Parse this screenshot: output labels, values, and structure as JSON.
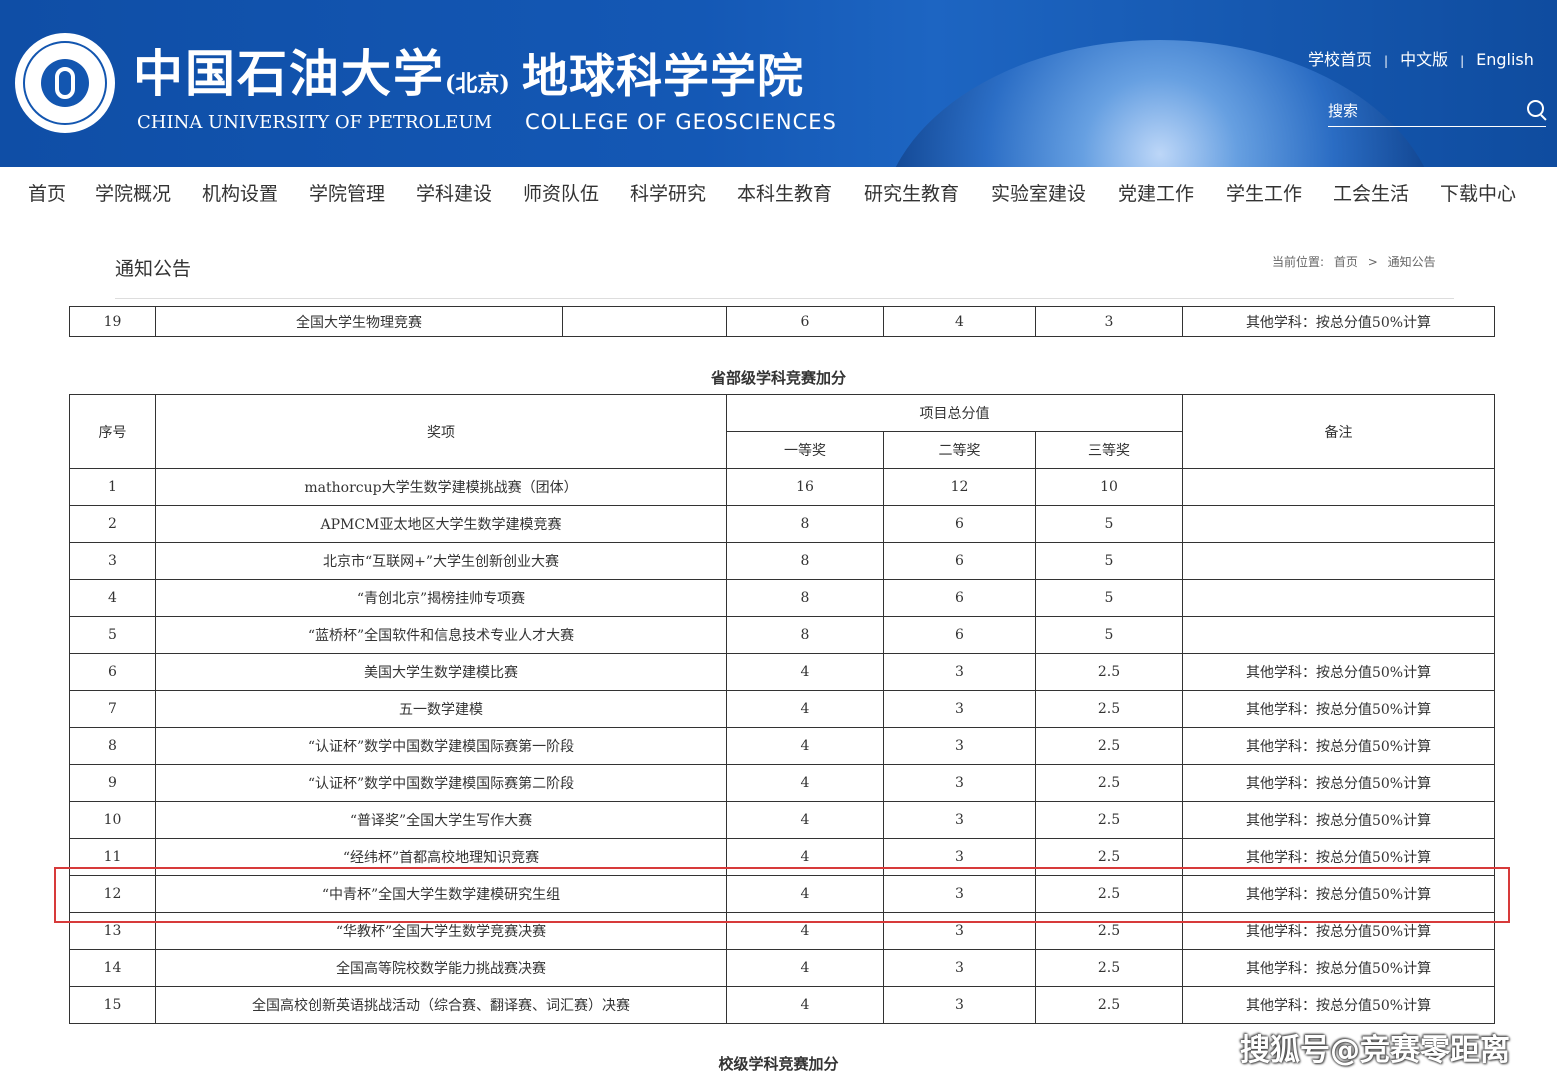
{
  "header": {
    "cn_university": "中国石油大学",
    "cn_university_suffix": "(北京)",
    "cn_college": "地球科学学院",
    "en_university": "CHINA UNIVERSITY OF PETROLEUM",
    "en_college": "COLLEGE OF GEOSCIENCES",
    "links": [
      "学校首页",
      "中文版",
      "English"
    ],
    "search_placeholder": "搜索"
  },
  "nav": [
    "首页",
    "学院概况",
    "机构设置",
    "学院管理",
    "学科建设",
    "师资队伍",
    "科学研究",
    "本科生教育",
    "研究生教育",
    "实验室建设",
    "党建工作",
    "学生工作",
    "工会生活",
    "下载中心"
  ],
  "page": {
    "title": "通知公告",
    "breadcrumb_label": "当前位置:",
    "breadcrumb": [
      "首页",
      ">",
      "通知公告"
    ]
  },
  "top_row": {
    "no": "19",
    "name": "全国大学生物理竞赛",
    "first": "6",
    "second": "4",
    "third": "3",
    "note": "其他学科：按总分值50%计算"
  },
  "section_provincial": "省部级学科竞赛加分",
  "section_school": "校级学科竞赛加分",
  "table": {
    "headers": {
      "no": "序号",
      "award": "奖项",
      "total": "项目总分值",
      "first": "一等奖",
      "second": "二等奖",
      "third": "三等奖",
      "note": "备注"
    },
    "rows": [
      {
        "no": "1",
        "name": "mathorcup大学生数学建模挑战赛（团体）",
        "first": "16",
        "second": "12",
        "third": "10",
        "note": ""
      },
      {
        "no": "2",
        "name": "APMCM亚太地区大学生数学建模竞赛",
        "first": "8",
        "second": "6",
        "third": "5",
        "note": ""
      },
      {
        "no": "3",
        "name": "北京市“互联网+”大学生创新创业大赛",
        "first": "8",
        "second": "6",
        "third": "5",
        "note": ""
      },
      {
        "no": "4",
        "name": "“青创北京”揭榜挂帅专项赛",
        "first": "8",
        "second": "6",
        "third": "5",
        "note": ""
      },
      {
        "no": "5",
        "name": "“蓝桥杯”全国软件和信息技术专业人才大赛",
        "first": "8",
        "second": "6",
        "third": "5",
        "note": ""
      },
      {
        "no": "6",
        "name": "美国大学生数学建模比赛",
        "first": "4",
        "second": "3",
        "third": "2.5",
        "note": "其他学科：按总分值50%计算"
      },
      {
        "no": "7",
        "name": "五一数学建模",
        "first": "4",
        "second": "3",
        "third": "2.5",
        "note": "其他学科：按总分值50%计算"
      },
      {
        "no": "8",
        "name": "“认证杯”数学中国数学建模国际赛第一阶段",
        "first": "4",
        "second": "3",
        "third": "2.5",
        "note": "其他学科：按总分值50%计算"
      },
      {
        "no": "9",
        "name": "“认证杯”数学中国数学建模国际赛第二阶段",
        "first": "4",
        "second": "3",
        "third": "2.5",
        "note": "其他学科：按总分值50%计算"
      },
      {
        "no": "10",
        "name": "“普译奖”全国大学生写作大赛",
        "first": "4",
        "second": "3",
        "third": "2.5",
        "note": "其他学科：按总分值50%计算"
      },
      {
        "no": "11",
        "name": "“经纬杯”首都高校地理知识竞赛",
        "first": "4",
        "second": "3",
        "third": "2.5",
        "note": "其他学科：按总分值50%计算"
      },
      {
        "no": "12",
        "name": "“中青杯”全国大学生数学建模研究生组",
        "first": "4",
        "second": "3",
        "third": "2.5",
        "note": "其他学科：按总分值50%计算"
      },
      {
        "no": "13",
        "name": "“华教杯”全国大学生数学竞赛决赛",
        "first": "4",
        "second": "3",
        "third": "2.5",
        "note": "其他学科：按总分值50%计算"
      },
      {
        "no": "14",
        "name": "全国高等院校数学能力挑战赛决赛",
        "first": "4",
        "second": "3",
        "third": "2.5",
        "note": "其他学科：按总分值50%计算"
      },
      {
        "no": "15",
        "name": "全国高校创新英语挑战活动（综合赛、翻译赛、词汇赛）决赛",
        "first": "4",
        "second": "3",
        "third": "2.5",
        "note": "其他学科：按总分值50%计算"
      }
    ]
  },
  "watermark": "搜狐号@竞赛零距离",
  "colors": {
    "header_blue": "#1458b5",
    "highlight_red": "#d73a3a"
  }
}
